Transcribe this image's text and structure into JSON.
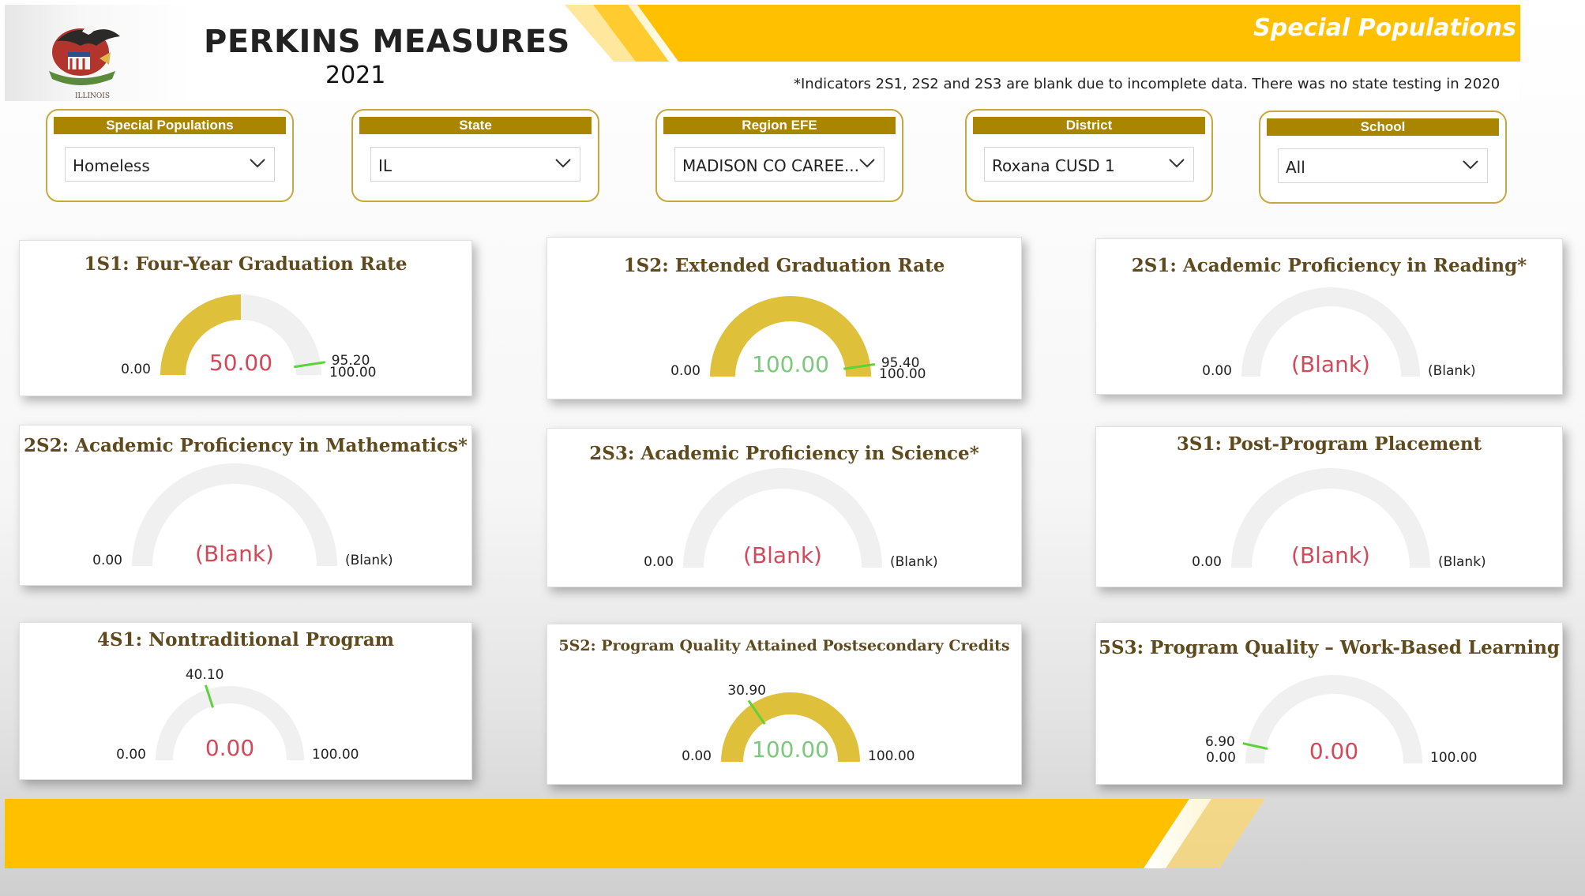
{
  "header": {
    "title": "PERKINS MEASURES",
    "year": "2021",
    "banner_label": "Special Populations",
    "note": "*Indicators 2S1, 2S2 and 2S3 are blank due to incomplete data. There was no state testing in 2020",
    "seal_text": "ILLINOIS"
  },
  "colors": {
    "gold": "#ffc000",
    "gauge_fill": "#dfc03a",
    "gauge_track": "#f0f0f0",
    "target_line": "#5fd23a",
    "value_red": "#d24a5a",
    "value_green": "#7cc87c",
    "title_brown": "#5f4a1e",
    "filter_label_bg": "#a98500"
  },
  "filters": [
    {
      "label": "Special Populations",
      "value": "Homeless"
    },
    {
      "label": "State",
      "value": "IL"
    },
    {
      "label": "Region EFE",
      "value": "MADISON CO CAREE..."
    },
    {
      "label": "District",
      "value": "Roxana CUSD 1"
    },
    {
      "label": "School",
      "value": "All"
    }
  ],
  "gauges": [
    {
      "title": "1S1: Four-Year Graduation Rate",
      "min": "0.00",
      "max": "100.00",
      "center": "50.00",
      "fraction": 0.5,
      "target": "95.20",
      "target_fraction": 0.952,
      "value_color": "red"
    },
    {
      "title": "1S2: Extended Graduation Rate",
      "min": "0.00",
      "max": "100.00",
      "center": "100.00",
      "fraction": 1.0,
      "target": "95.40",
      "target_fraction": 0.954,
      "value_color": "green"
    },
    {
      "title": "2S1: Academic Proficiency in Reading*",
      "min": "0.00",
      "max": "(Blank)",
      "center": "(Blank)",
      "fraction": 0,
      "target": "",
      "target_fraction": null,
      "value_color": "red"
    },
    {
      "title": "2S2: Academic Proficiency in Mathematics*",
      "min": "0.00",
      "max": "(Blank)",
      "center": "(Blank)",
      "fraction": 0,
      "target": "",
      "target_fraction": null,
      "value_color": "red"
    },
    {
      "title": "2S3: Academic Proficiency in Science*",
      "min": "0.00",
      "max": "(Blank)",
      "center": "(Blank)",
      "fraction": 0,
      "target": "",
      "target_fraction": null,
      "value_color": "red"
    },
    {
      "title": "3S1: Post-Program Placement",
      "min": "0.00",
      "max": "(Blank)",
      "center": "(Blank)",
      "fraction": 0,
      "target": "",
      "target_fraction": null,
      "value_color": "red"
    },
    {
      "title": "4S1: Nontraditional Program",
      "min": "0.00",
      "max": "100.00",
      "center": "0.00",
      "fraction": 0,
      "target": "40.10",
      "target_fraction": 0.401,
      "value_color": "red"
    },
    {
      "title": "5S2: Program Quality Attained Postsecondary Credits",
      "min": "0.00",
      "max": "100.00",
      "center": "100.00",
      "fraction": 1.0,
      "target": "30.90",
      "target_fraction": 0.309,
      "value_color": "green"
    },
    {
      "title": "5S3: Program Quality – Work-Based Learning",
      "min": "0.00",
      "max": "100.00",
      "center": "0.00",
      "fraction": 0,
      "target": "6.90",
      "target_fraction": 0.069,
      "value_color": "red"
    }
  ]
}
